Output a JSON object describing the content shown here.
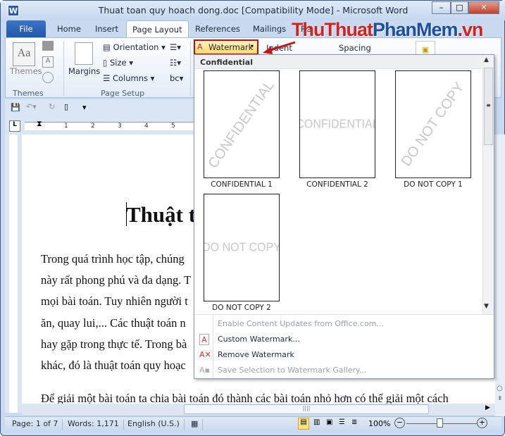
{
  "window": {
    "title": "Thuat toan quy hoach dong.doc [Compatibility Mode]  -  Microsoft Word",
    "app_icon": "W"
  },
  "watermark_brand": {
    "part1": "ThuThuat",
    "part2": "PhanMem",
    "part3": ".vn"
  },
  "tabs": [
    {
      "label": "File"
    },
    {
      "label": "Home"
    },
    {
      "label": "Insert"
    },
    {
      "label": "Page Layout"
    },
    {
      "label": "References"
    },
    {
      "label": "Mailings"
    },
    {
      "label": "Re"
    }
  ],
  "ribbon": {
    "themes": {
      "label": "Themes",
      "group": "Themes"
    },
    "page_setup": {
      "margins": "Margins",
      "orientation": "Orientation",
      "size": "Size",
      "columns": "Columns",
      "group": "Page Setup"
    },
    "watermark": "Watermark",
    "indent": "Indent",
    "spacing": "Spacing"
  },
  "ruler": {
    "marks": [
      "1",
      "2",
      "3",
      "4",
      "5"
    ]
  },
  "document": {
    "title": "Thuật t",
    "lines": [
      "Trong quá trình học tập, chúng",
      "này rất phong phú và đa dạng. T",
      "mọi bài toán. Tuy nhiên người t",
      "ăn, quay lui,... Các thuật toán n",
      "hay gặp trong thực tế. Trong bà",
      "khác, đó là thuật toán quy hoạc"
    ],
    "line7": "Để giải một bài toán ta chia bài toán đó thành các bài toán nhỏ hơn có thể giải một cách"
  },
  "gallery": {
    "section": "Confidential",
    "items": [
      {
        "label": "CONFIDENTIAL 1",
        "text": "CONFIDENTIAL",
        "style": "diagonal"
      },
      {
        "label": "CONFIDENTIAL 2",
        "text": "CONFIDENTIAL",
        "style": "horizontal"
      },
      {
        "label": "DO NOT COPY 1",
        "text": "DO NOT COPY",
        "style": "diagonal"
      },
      {
        "label": "DO NOT COPY 2",
        "text": "DO NOT COPY",
        "style": "horizontal"
      }
    ]
  },
  "menu": [
    {
      "label": "Enable Content Updates from Office.com...",
      "enabled": false,
      "icon": ""
    },
    {
      "label": "Custom Watermark...",
      "enabled": true,
      "icon": "custom-watermark-icon"
    },
    {
      "label": "Remove Watermark",
      "enabled": true,
      "icon": "remove-watermark-icon"
    },
    {
      "label": "Save Selection to Watermark Gallery...",
      "enabled": false,
      "icon": "save-gallery-icon"
    }
  ],
  "status": {
    "page": "Page: 1 of 7",
    "words": "Words: 1,171",
    "language": "English (U.S.)",
    "zoom": "100%",
    "zoom_value": 100
  }
}
